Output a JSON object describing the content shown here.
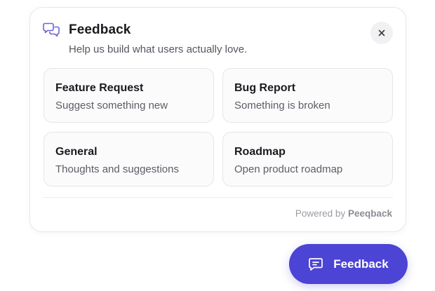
{
  "panel": {
    "header_icon": "chat-bubbles-icon",
    "title": "Feedback",
    "subtitle": "Help us build what users actually love.",
    "close_icon": "close-icon",
    "close_glyph": "×"
  },
  "cards": [
    {
      "title": "Feature Request",
      "description": "Suggest something new"
    },
    {
      "title": "Bug Report",
      "description": "Something is broken"
    },
    {
      "title": "General",
      "description": "Thoughts and suggestions"
    },
    {
      "title": "Roadmap",
      "description": "Open product roadmap"
    }
  ],
  "footer": {
    "powered_prefix": "Powered by",
    "brand": "Peeqback"
  },
  "fab": {
    "icon": "message-square-icon",
    "label": "Feedback"
  },
  "colors": {
    "accent": "#4c44d4",
    "header_icon": "#6b63d8"
  }
}
